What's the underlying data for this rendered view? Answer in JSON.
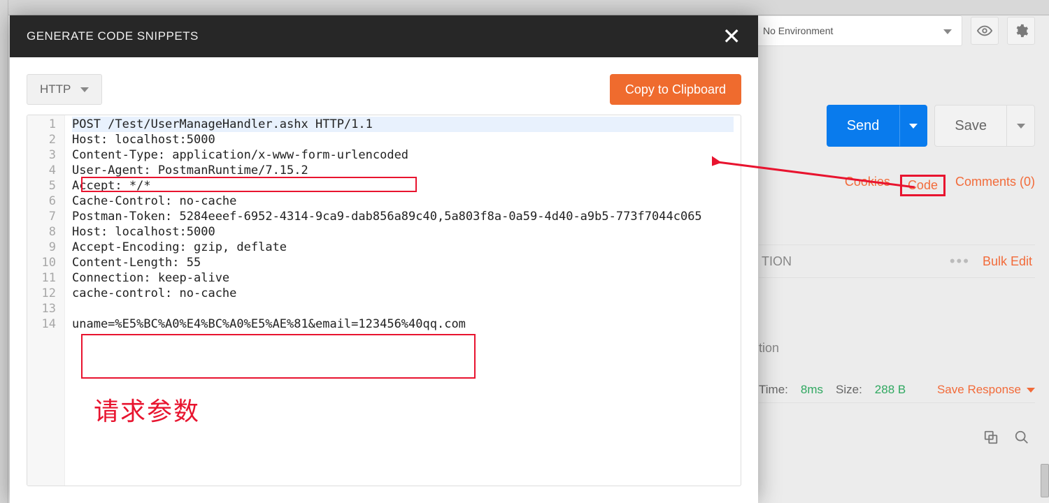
{
  "env": {
    "label": "No Environment"
  },
  "request": {
    "send_label": "Send",
    "save_label": "Save"
  },
  "links": {
    "cookies": "Cookies",
    "code": "Code",
    "comments": "Comments (0)"
  },
  "section": {
    "title_suffix": "TION",
    "bulk_edit": "Bulk Edit",
    "row_suffix": "tion"
  },
  "status": {
    "time_label": "Time:",
    "time_value": "8ms",
    "size_label": "Size:",
    "size_value": "288 B",
    "save_response": "Save Response"
  },
  "modal": {
    "title": "GENERATE CODE SNIPPETS",
    "lang": "HTTP",
    "copy_label": "Copy to Clipboard"
  },
  "code_lines": [
    "POST /Test/UserManageHandler.ashx HTTP/1.1",
    "Host: localhost:5000",
    "Content-Type: application/x-www-form-urlencoded",
    "User-Agent: PostmanRuntime/7.15.2",
    "Accept: */*",
    "Cache-Control: no-cache",
    "Postman-Token: 5284eeef-6952-4314-9ca9-dab856a89c40,5a803f8a-0a59-4d40-a9b5-773f7044c065",
    "Host: localhost:5000",
    "Accept-Encoding: gzip, deflate",
    "Content-Length: 55",
    "Connection: keep-alive",
    "cache-control: no-cache",
    "",
    "uname=%E5%BC%A0%E4%BC%A0%E5%AE%81&email=123456%40qq.com"
  ],
  "annotation": {
    "label": "请求参数"
  }
}
